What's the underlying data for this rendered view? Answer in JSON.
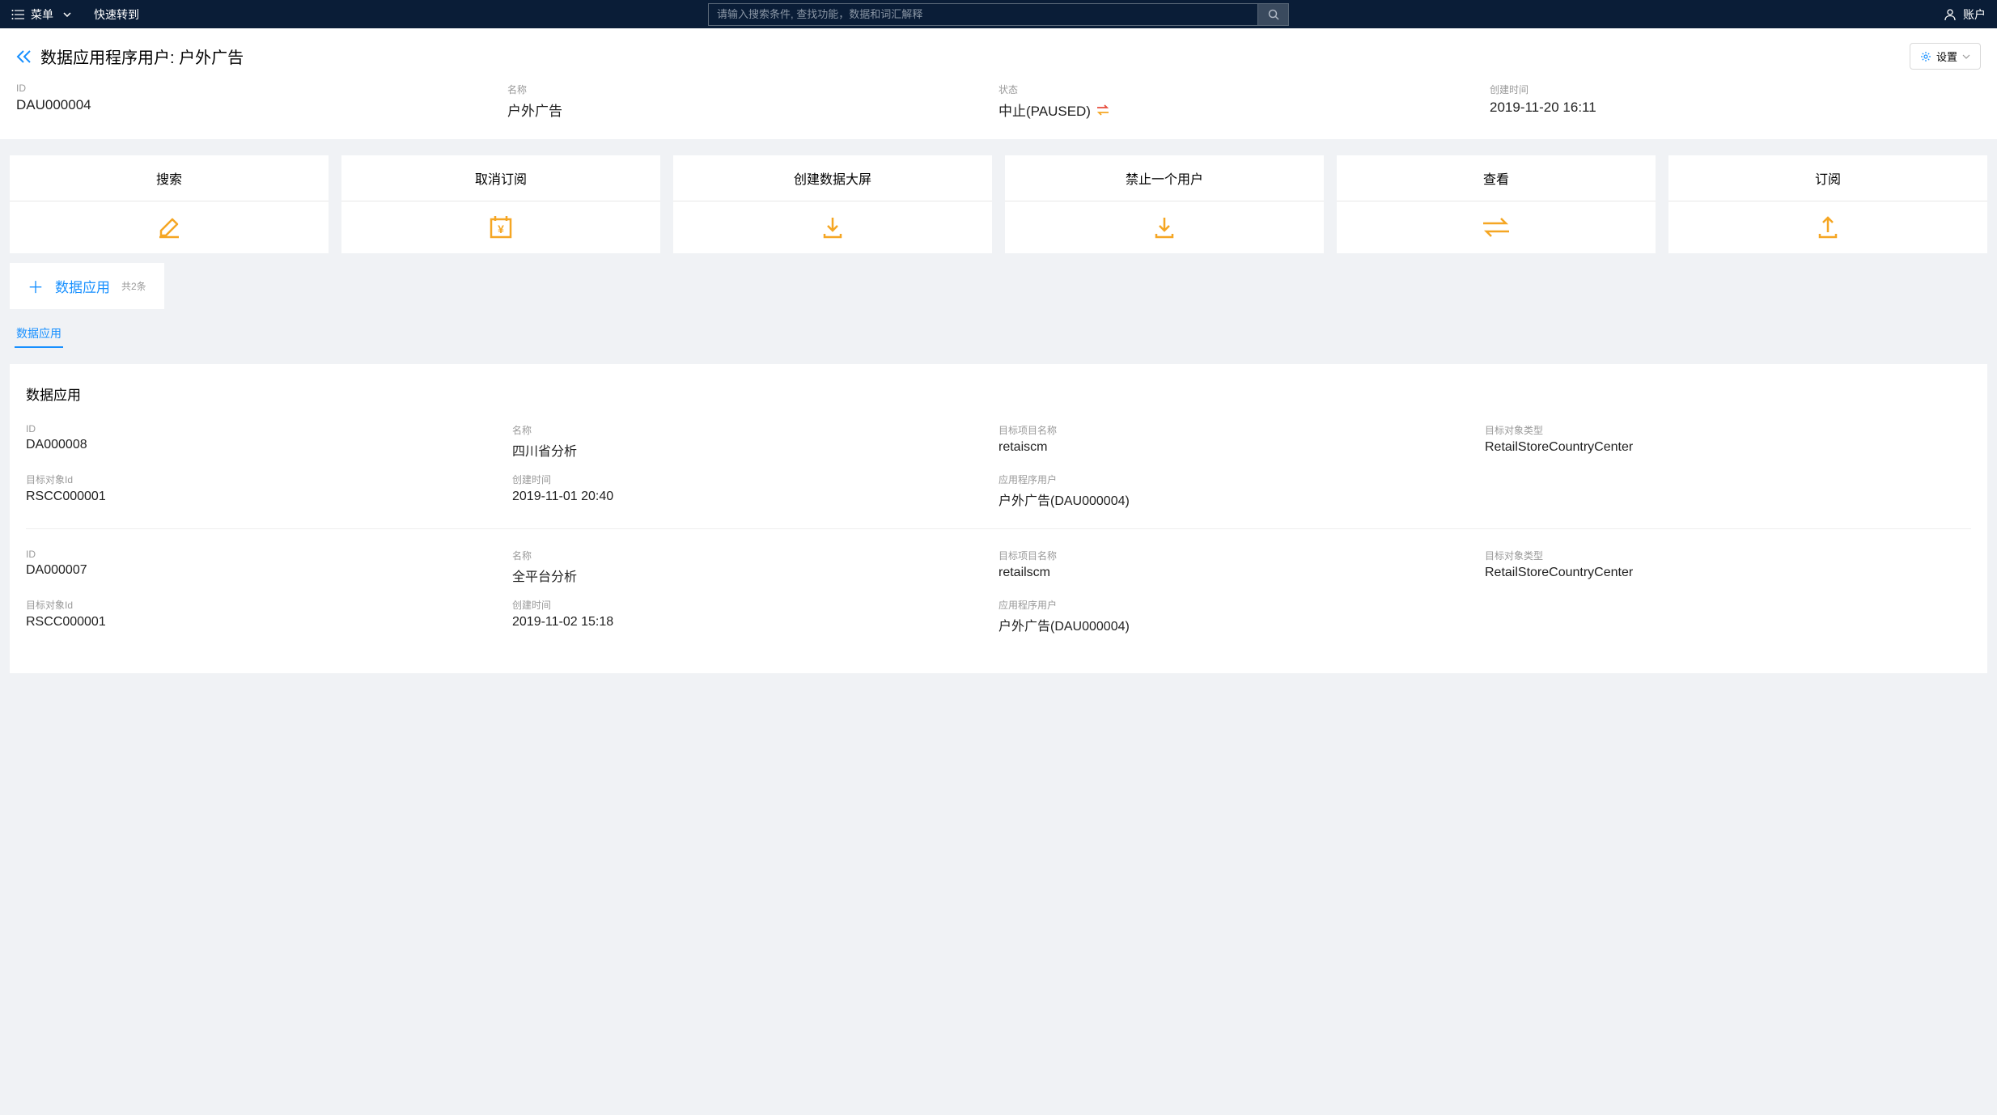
{
  "header": {
    "menu_label": "菜单",
    "quick_nav": "快速转到",
    "search_placeholder": "请输入搜索条件, 查找功能，数据和词汇解释",
    "account_label": "账户"
  },
  "page": {
    "title": "数据应用程序用户: 户外广告",
    "settings_label": "设置"
  },
  "meta": {
    "id_label": "ID",
    "id_value": "DAU000004",
    "name_label": "名称",
    "name_value": "户外广告",
    "status_label": "状态",
    "status_value": "中止(PAUSED)",
    "created_label": "创建时间",
    "created_value": "2019-11-20 16:11"
  },
  "actions": {
    "search": "搜索",
    "unsubscribe": "取消订阅",
    "create_dashboard": "创建数据大屏",
    "ban_user": "禁止一个用户",
    "view": "查看",
    "subscribe": "订阅"
  },
  "tab_block": {
    "label": "数据应用",
    "count": "共2条",
    "tab_label": "数据应用"
  },
  "panel": {
    "title": "数据应用",
    "labels": {
      "id": "ID",
      "name": "名称",
      "target_project": "目标项目名称",
      "target_object_type": "目标对象类型",
      "target_object_id": "目标对象Id",
      "created_time": "创建时间",
      "app_user": "应用程序用户"
    },
    "records": [
      {
        "id": "DA000008",
        "name": "四川省分析",
        "target_project": "retaiscm",
        "target_object_type": "RetailStoreCountryCenter",
        "target_object_id": "RSCC000001",
        "created_time": "2019-11-01 20:40",
        "app_user": "户外广告(DAU000004)"
      },
      {
        "id": "DA000007",
        "name": "全平台分析",
        "target_project": "retailscm",
        "target_object_type": "RetailStoreCountryCenter",
        "target_object_id": "RSCC000001",
        "created_time": "2019-11-02 15:18",
        "app_user": "户外广告(DAU000004)"
      }
    ]
  }
}
